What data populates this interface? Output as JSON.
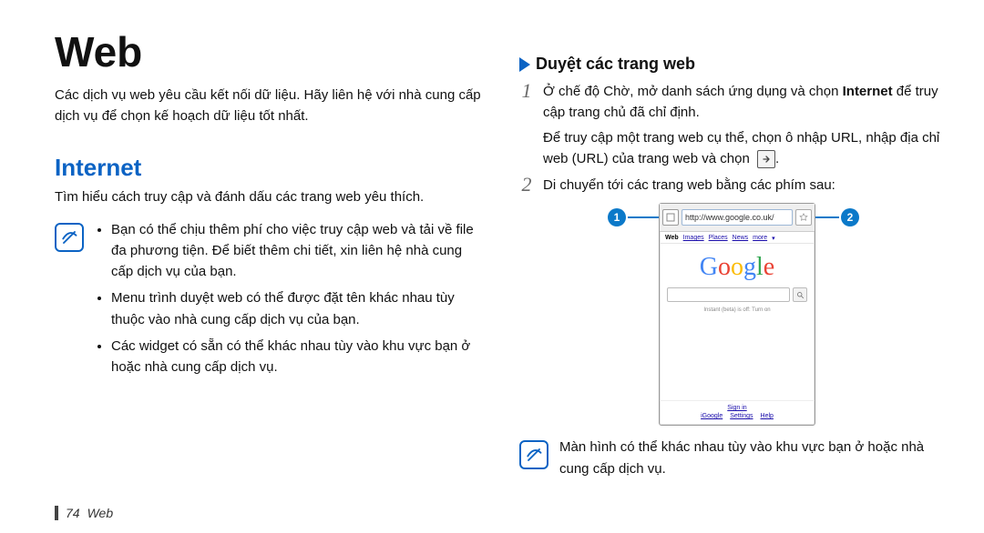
{
  "page": {
    "title": "Web",
    "intro": "Các dịch vụ web yêu cầu kết nối dữ liệu. Hãy liên hệ với nhà cung cấp dịch vụ để chọn kế hoạch dữ liệu tốt nhất.",
    "footer_number": "74",
    "footer_section": "Web"
  },
  "internet": {
    "heading": "Internet",
    "sub_intro": "Tìm hiểu cách truy cập và đánh dấu các trang web yêu thích.",
    "note_bullets": [
      "Bạn có thể chịu thêm phí cho việc truy cập web và tải về file đa phương tiện. Để biết thêm chi tiết, xin liên hệ nhà cung cấp dịch vụ của bạn.",
      "Menu trình duyệt web có thể được đặt tên khác nhau tùy thuộc vào nhà cung cấp dịch vụ của bạn.",
      "Các widget có sẵn có thể khác nhau tùy vào khu vực bạn ở hoặc nhà cung cấp dịch vụ."
    ]
  },
  "browse": {
    "section_title": "Duyệt các trang web",
    "steps": [
      {
        "num": "1",
        "para1_pre": "Ở chế độ Chờ, mở danh sách ứng dụng và chọn ",
        "para1_bold": "Internet",
        "para1_post": " để truy cập trang chủ đã chỉ định.",
        "para2_pre": "Để truy cập một trang web cụ thể, chọn ô nhập URL, nhập địa chỉ web (URL) của trang web và chọn ",
        "para2_post": "."
      },
      {
        "num": "2",
        "para1": "Di chuyển tới các trang web bằng các phím sau:"
      }
    ],
    "screenshot": {
      "url": "http://www.google.co.uk/",
      "nav_items": [
        "Web",
        "Images",
        "Places",
        "News",
        "more"
      ],
      "logo_text": "Google",
      "instant_text": "Instant (beta) is off: Turn on",
      "footer_signin": "Sign in",
      "footer_links": [
        "iGoogle",
        "Settings",
        "Help"
      ],
      "callout_1": "1",
      "callout_2": "2"
    },
    "note": "Màn hình có thể khác nhau tùy vào khu vực bạn ở hoặc nhà cung cấp dịch vụ."
  }
}
